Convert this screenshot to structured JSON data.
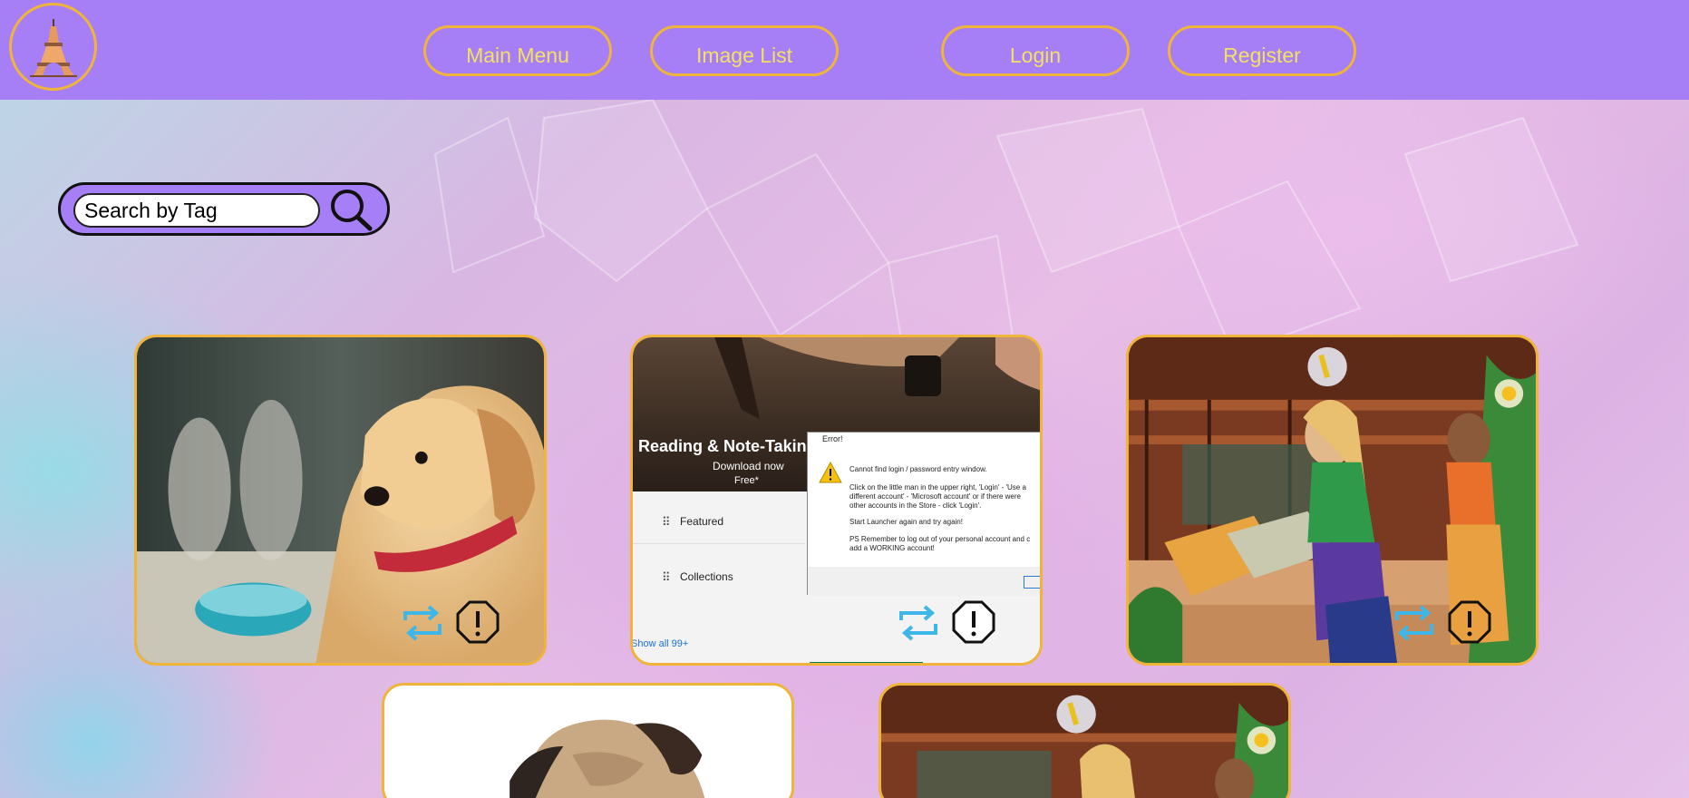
{
  "header": {
    "logo_icon": "eiffel-tower-icon",
    "nav": [
      {
        "label": "Main Menu"
      },
      {
        "label": "Image List"
      },
      {
        "label": "Login"
      },
      {
        "label": "Register"
      }
    ]
  },
  "search": {
    "placeholder": "Search by Tag",
    "button_icon": "search-icon"
  },
  "cards": [
    {
      "subject": "golden retriever puppy",
      "repost_icon": "repost-icon",
      "report_icon": "report-icon"
    },
    {
      "subject": "app store error screenshot",
      "repost_icon": "repost-icon",
      "report_icon": "report-icon",
      "screenshot": {
        "banner_title": "Reading & Note-Taking",
        "banner_cta": "Download now",
        "banner_price": "Free*",
        "menu_items": [
          "Featured",
          "Collections"
        ],
        "show_all": "Show all 99+",
        "dialog_title": "Error!",
        "dialog_lines": [
          "Cannot find login / password entry window.",
          "Click on the little man in the upper right, 'Login' - 'Use a",
          "different account' - 'Microsoft account' or if there were",
          "other accounts in the Store - click 'Login'.",
          "Start Launcher again and try again!",
          "PS Remember to log out of your personal account and c",
          "add a WORKING account!"
        ]
      }
    },
    {
      "subject": "sims island resort scene",
      "repost_icon": "repost-icon",
      "report_icon": "report-icon"
    },
    {
      "subject": "pug puppy"
    },
    {
      "subject": "sims island resort scene"
    }
  ],
  "colors": {
    "header_bg": "#a67ff7",
    "accent_border": "#f0b43a",
    "nav_text": "#f4e062",
    "repost_icon": "#3fb6e8"
  }
}
